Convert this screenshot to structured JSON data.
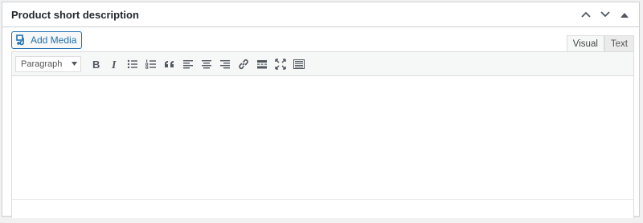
{
  "metabox": {
    "title": "Product short description"
  },
  "media": {
    "add_media_label": "Add Media"
  },
  "tabs": [
    {
      "label": "Visual",
      "active": true
    },
    {
      "label": "Text",
      "active": false
    }
  ],
  "toolbar": {
    "format_value": "Paragraph"
  }
}
